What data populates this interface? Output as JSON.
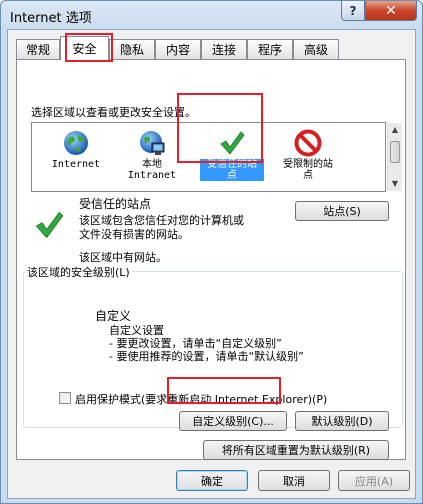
{
  "window": {
    "title": "Internet 选项",
    "help_glyph": "?",
    "close_glyph": "✕"
  },
  "tabs": [
    {
      "label": "常规"
    },
    {
      "label": "安全"
    },
    {
      "label": "隐私"
    },
    {
      "label": "内容"
    },
    {
      "label": "连接"
    },
    {
      "label": "程序"
    },
    {
      "label": "高级"
    }
  ],
  "active_tab": "安全",
  "security": {
    "select_zone_label": "选择区域以查看或更改安全设置。",
    "zones": [
      {
        "line1": "Internet",
        "line2": "",
        "icon": "globe-icon"
      },
      {
        "line1": "本地",
        "line2": "Intranet",
        "icon": "intranet-icon"
      },
      {
        "line1": "受信任的站",
        "line2": "点",
        "icon": "checkmark-icon",
        "selected": true
      },
      {
        "line1": "受限制的站",
        "line2": "点",
        "icon": "restricted-icon"
      }
    ],
    "zone_title": "受信任的站点",
    "zone_desc_1": "该区域包含您信任对您的计算机或",
    "zone_desc_2": "文件没有损害的网站。",
    "zone_no_sites": "该区域中有网站。",
    "sites_button": "站点(S)",
    "level_group_label": "该区域的安全级别(L)",
    "level_name": "自定义",
    "level_desc_1": "自定义设置",
    "level_desc_2": "- 要更改设置，请单击“自定义级别”",
    "level_desc_3": "- 要使用推荐的设置，请单击“默认级别”",
    "protected_mode_label": "启用保护模式(要求重新启动 Internet Explorer)(P)",
    "custom_level_button": "自定义级别(C)...",
    "default_level_button": "默认级别(D)",
    "reset_all_button": "将所有区域重置为默认级别(R)"
  },
  "footer": {
    "ok": "确定",
    "cancel": "取消",
    "apply": "应用(A)"
  },
  "colors": {
    "highlight_red": "#e0212c",
    "selection_blue": "#3399ff",
    "check_green": "#2eaa3e",
    "restricted_red": "#d6201f"
  }
}
